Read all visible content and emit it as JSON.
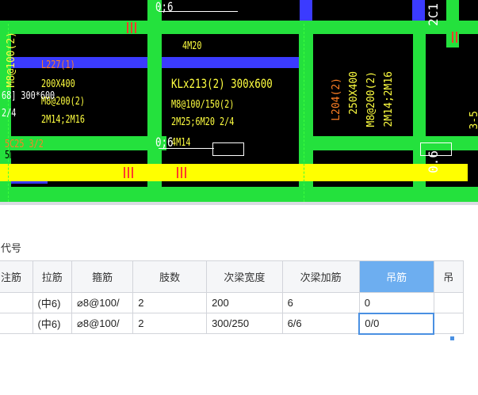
{
  "canvas": {
    "labels": {
      "top_dim": "0;6",
      "tl_vertical": "M8@100(2)",
      "l227": "L227(1)",
      "l227_size": "200X400",
      "l227_stirrup": "M8@200(2)",
      "l227_bar": "2M14;2M16",
      "left_span": "68] 300*600",
      "left_bar": "2/4",
      "mid_top": "4M20",
      "kl_title": "KLx213(2) 300x600",
      "kl_stirrup": "M8@100/150(2)",
      "kl_bar": "2M25;6M20 2/4",
      "kl_extra": "4M14",
      "mid_dim": "0;6",
      "yellow_label": "5C25 3/2",
      "yellow_bar": "5M25 3/2",
      "l204": "L204(2)",
      "l204_size": "250X400",
      "l204_stirrup": "M8@200(2)",
      "l204_bar": "2M14;2M16",
      "right_c": "2C1",
      "right_dim": "0.6",
      "far_right": "3-5"
    }
  },
  "panel": {
    "title": "代号",
    "table": {
      "headers": [
        "注筋",
        "拉筋",
        "箍筋",
        "肢数",
        "次梁宽度",
        "次梁加筋",
        "吊筋",
        "吊"
      ],
      "rows": [
        [
          "",
          "(中6)",
          "⌀8@100/",
          "2",
          "200",
          "6",
          "0",
          ""
        ],
        [
          "",
          "(中6)",
          "⌀8@100/",
          "2",
          "300/250",
          "6/6",
          "0/0",
          ""
        ]
      ]
    }
  },
  "colors": {
    "green_beam": "#24e13d",
    "yellow_beam": "#ffff00",
    "blue_beam": "#3b3bff",
    "selected_header": "#6daef0"
  }
}
